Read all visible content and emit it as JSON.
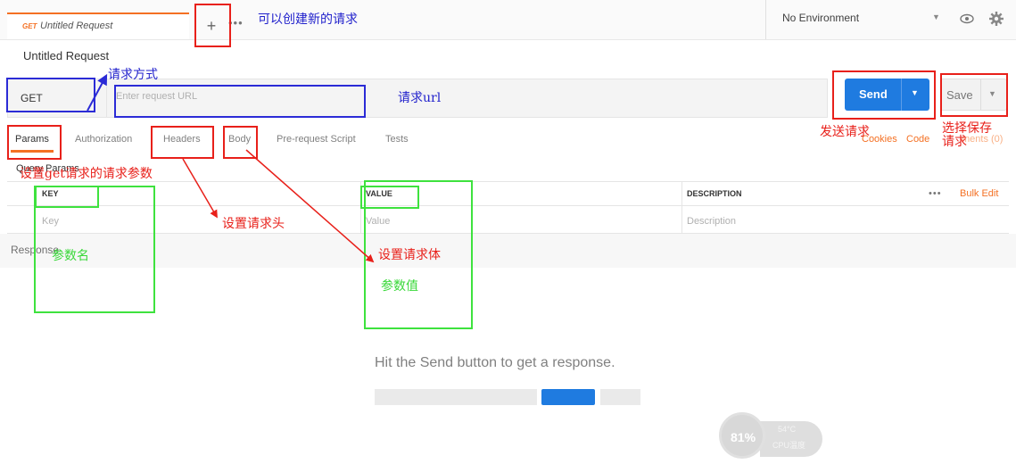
{
  "tab": {
    "method": "GET",
    "name": "Untitled Request"
  },
  "top": {
    "plus": "+",
    "more": "•••"
  },
  "environment": {
    "label": "No Environment"
  },
  "request": {
    "title": "Untitled Request",
    "method": "GET",
    "url_placeholder": "Enter request URL",
    "send_label": "Send",
    "save_label": "Save"
  },
  "subtabs": [
    "Params",
    "Authorization",
    "Headers",
    "Body",
    "Pre-request Script",
    "Tests"
  ],
  "links": {
    "cookies": "Cookies",
    "code": "Code",
    "comments": "ments (0)"
  },
  "query": {
    "title": "Query Params",
    "columns": [
      "KEY",
      "VALUE",
      "DESCRIPTION"
    ],
    "placeholders": [
      "Key",
      "Value",
      "Description"
    ],
    "more": "•••",
    "bulk_edit": "Bulk Edit"
  },
  "response": {
    "label": "Response",
    "hint": "Hit the Send button to get a response."
  },
  "cpu": {
    "percent": "81%",
    "temp": "54°C",
    "label": "CPU温度"
  },
  "annotations": {
    "new_request": "可以创建新的请求",
    "method": "请求方式",
    "url": "请求url",
    "send": "发送请求",
    "save": "选择保存请求",
    "params": "设置get请求的请求参数",
    "headers": "设置请求头",
    "body": "设置请求体",
    "param_name": "参数名",
    "param_value": "参数值"
  },
  "colors": {
    "accent": "#f47023",
    "send": "#1f7be0",
    "annot_red": "#e8201a",
    "annot_blue": "#2b2bd6",
    "annot_green": "#3ee23e"
  }
}
